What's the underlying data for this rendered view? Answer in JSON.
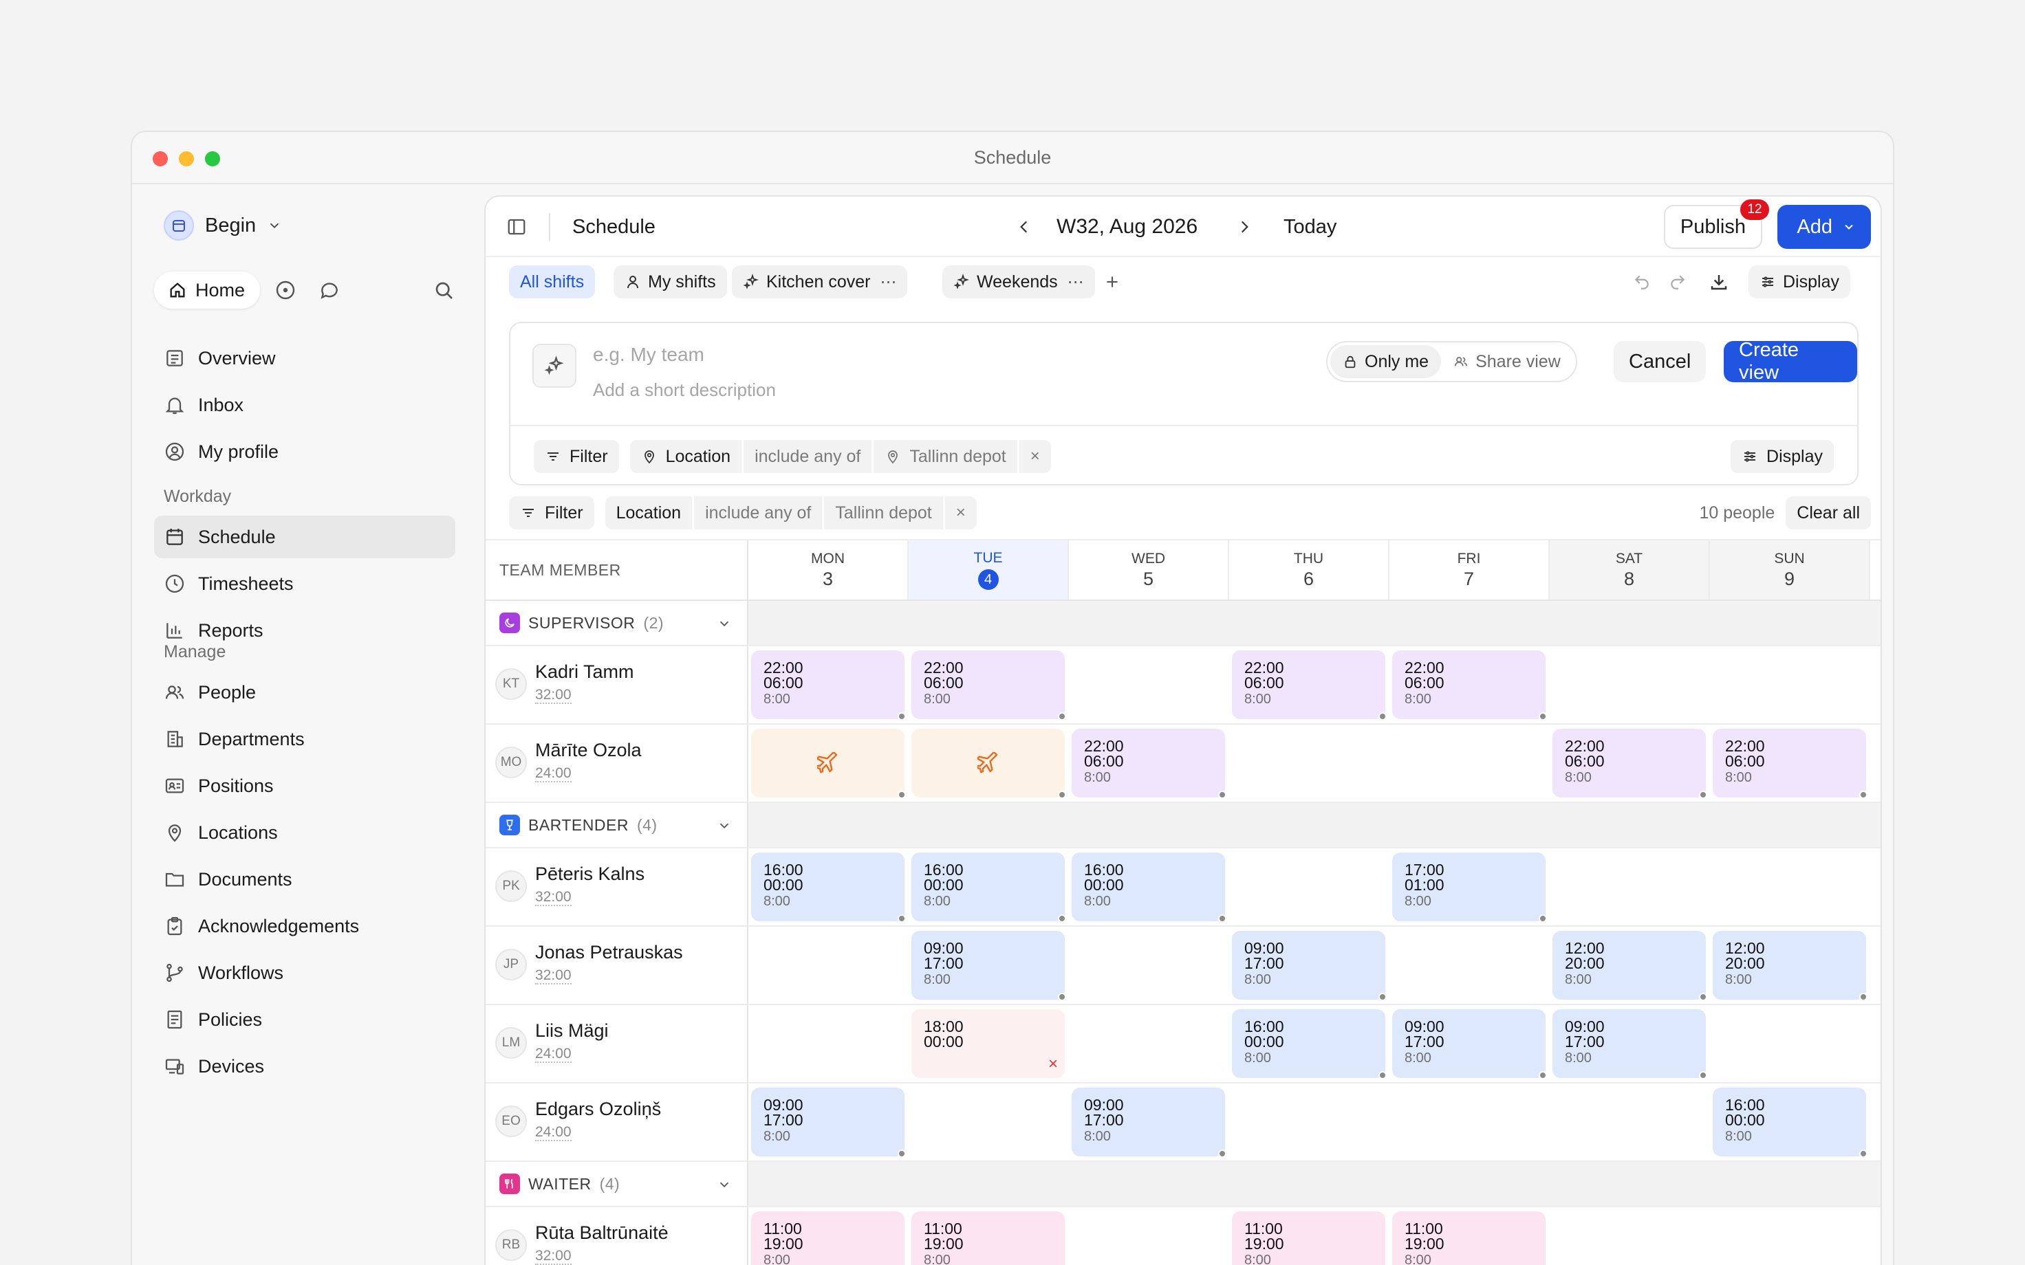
{
  "window": {
    "title": "Schedule"
  },
  "sidebar": {
    "workspace": "Begin",
    "home_label": "Home",
    "top_items": [
      {
        "label": "Overview"
      },
      {
        "label": "Inbox"
      },
      {
        "label": "My profile"
      }
    ],
    "workday_heading": "Workday",
    "workday_items": [
      {
        "label": "Schedule"
      },
      {
        "label": "Timesheets"
      },
      {
        "label": "Reports"
      }
    ],
    "manage_heading": "Manage",
    "manage_items": [
      {
        "label": "People"
      },
      {
        "label": "Departments"
      },
      {
        "label": "Positions"
      },
      {
        "label": "Locations"
      },
      {
        "label": "Documents"
      },
      {
        "label": "Acknowledgements"
      },
      {
        "label": "Workflows"
      },
      {
        "label": "Policies"
      },
      {
        "label": "Devices"
      }
    ]
  },
  "topbar": {
    "title": "Schedule",
    "week": "W32, Aug 2026",
    "today": "Today",
    "publish": "Publish",
    "publish_badge": "12",
    "add": "Add"
  },
  "tabs": {
    "all": "All shifts",
    "my": "My shifts",
    "kitchen": "Kitchen cover",
    "weekends": "Weekends",
    "display": "Display"
  },
  "new_view": {
    "name_placeholder": "e.g. My team",
    "desc_placeholder": "Add a short description",
    "only_me": "Only me",
    "share_view": "Share view",
    "cancel": "Cancel",
    "create": "Create view",
    "filter": "Filter",
    "field": "Location",
    "op": "include any of",
    "value": "Tallinn depot",
    "display": "Display"
  },
  "filters": {
    "filter": "Filter",
    "field": "Location",
    "op": "include any of",
    "value": "Tallinn depot",
    "people": "10 people",
    "clear": "Clear all"
  },
  "grid": {
    "member_header": "TEAM MEMBER",
    "days": [
      {
        "name": "MON",
        "num": "3"
      },
      {
        "name": "TUE",
        "num": "4"
      },
      {
        "name": "WED",
        "num": "5"
      },
      {
        "name": "THU",
        "num": "6"
      },
      {
        "name": "FRI",
        "num": "7"
      },
      {
        "name": "SAT",
        "num": "8"
      },
      {
        "name": "SUN",
        "num": "9"
      }
    ],
    "groups": [
      {
        "name": "SUPERVISOR",
        "count": "(2)",
        "color": "#a83ee0"
      },
      {
        "name": "BARTENDER",
        "count": "(4)",
        "color": "#2f6df0"
      },
      {
        "name": "WAITER",
        "count": "(4)",
        "color": "#e2368e"
      }
    ],
    "people": [
      {
        "initials": "KT",
        "name": "Kadri Tamm",
        "hours": "32:00"
      },
      {
        "initials": "MO",
        "name": "Mārīte Ozola",
        "hours": "24:00"
      },
      {
        "initials": "PK",
        "name": "Pēteris Kalns",
        "hours": "32:00"
      },
      {
        "initials": "JP",
        "name": "Jonas Petrauskas",
        "hours": "32:00"
      },
      {
        "initials": "LM",
        "name": "Liis Mägi",
        "hours": "24:00"
      },
      {
        "initials": "EO",
        "name": "Edgars Ozoliņš",
        "hours": "24:00"
      },
      {
        "initials": "RB",
        "name": "Rūta Baltrūnaitė",
        "hours": "32:00"
      }
    ],
    "shifts": {
      "kt": [
        {
          "start": "22:00",
          "end": "06:00",
          "dur": "8:00"
        },
        {
          "start": "22:00",
          "end": "06:00",
          "dur": "8:00"
        },
        {
          "start": "22:00",
          "end": "06:00",
          "dur": "8:00"
        },
        {
          "start": "22:00",
          "end": "06:00",
          "dur": "8:00"
        }
      ],
      "mo": [
        {
          "start": "22:00",
          "end": "06:00",
          "dur": "8:00"
        },
        {
          "start": "22:00",
          "end": "06:00",
          "dur": "8:00"
        },
        {
          "start": "22:00",
          "end": "06:00",
          "dur": "8:00"
        }
      ],
      "pk": [
        {
          "start": "16:00",
          "end": "00:00",
          "dur": "8:00"
        },
        {
          "start": "16:00",
          "end": "00:00",
          "dur": "8:00"
        },
        {
          "start": "16:00",
          "end": "00:00",
          "dur": "8:00"
        },
        {
          "start": "17:00",
          "end": "01:00",
          "dur": "8:00"
        }
      ],
      "jp": [
        {
          "start": "09:00",
          "end": "17:00",
          "dur": "8:00"
        },
        {
          "start": "09:00",
          "end": "17:00",
          "dur": "8:00"
        },
        {
          "start": "12:00",
          "end": "20:00",
          "dur": "8:00"
        },
        {
          "start": "12:00",
          "end": "20:00",
          "dur": "8:00"
        }
      ],
      "lm": [
        {
          "start": "18:00",
          "end": "00:00"
        },
        {
          "start": "16:00",
          "end": "00:00",
          "dur": "8:00"
        },
        {
          "start": "09:00",
          "end": "17:00",
          "dur": "8:00"
        },
        {
          "start": "09:00",
          "end": "17:00",
          "dur": "8:00"
        }
      ],
      "eo": [
        {
          "start": "09:00",
          "end": "17:00",
          "dur": "8:00"
        },
        {
          "start": "09:00",
          "end": "17:00",
          "dur": "8:00"
        },
        {
          "start": "16:00",
          "end": "00:00",
          "dur": "8:00"
        }
      ],
      "rb": [
        {
          "start": "11:00",
          "end": "19:00",
          "dur": "8:00"
        },
        {
          "start": "11:00",
          "end": "19:00",
          "dur": "8:00"
        },
        {
          "start": "11:00",
          "end": "19:00",
          "dur": "8:00"
        },
        {
          "start": "11:00",
          "end": "19:00",
          "dur": "8:00"
        }
      ]
    }
  }
}
